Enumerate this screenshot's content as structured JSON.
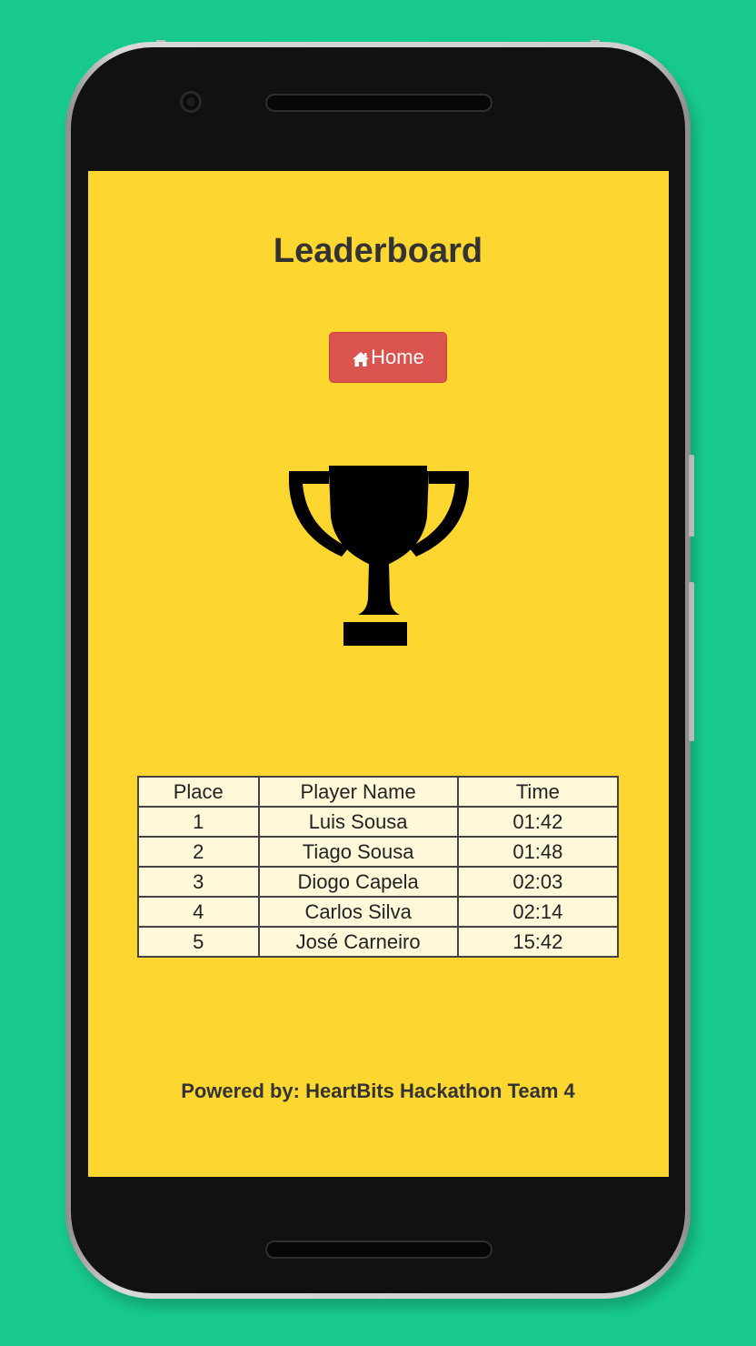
{
  "page": {
    "title": "Leaderboard",
    "home_button": {
      "label": "Home",
      "icon": "home-icon"
    },
    "trophy_icon": "trophy-icon",
    "footer": "Powered by: HeartBits Hackathon Team 4"
  },
  "leaderboard": {
    "columns": [
      "Place",
      "Player Name",
      "Time"
    ],
    "rows": [
      {
        "place": "1",
        "name": "Luis Sousa",
        "time": "01:42"
      },
      {
        "place": "2",
        "name": "Tiago Sousa",
        "time": "01:48"
      },
      {
        "place": "3",
        "name": "Diogo Capela",
        "time": "02:03"
      },
      {
        "place": "4",
        "name": "Carlos Silva",
        "time": "02:14"
      },
      {
        "place": "5",
        "name": "José Carneiro",
        "time": "15:42"
      }
    ]
  },
  "colors": {
    "background": "#17c98c",
    "screen": "#fed630",
    "button": "#d9534f",
    "table_bg": "#fff8d9",
    "text": "#333333"
  }
}
